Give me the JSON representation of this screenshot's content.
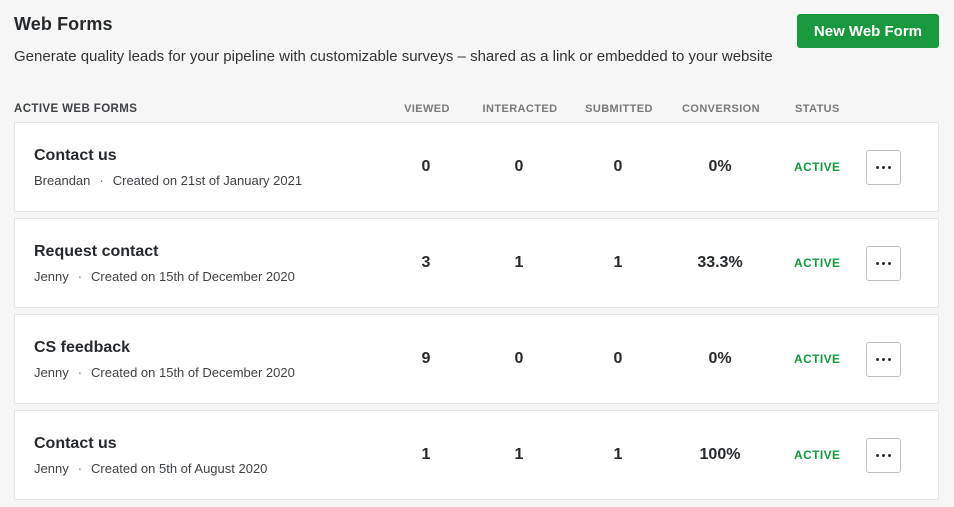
{
  "page": {
    "title": "Web Forms",
    "subtitle": "Generate quality leads for your pipeline with customizable surveys – shared as a link or embedded to your website",
    "new_button_label": "New Web Form"
  },
  "colors": {
    "button_green": "#18993d",
    "status_active_green": "#129c3e"
  },
  "table": {
    "meta_separator": "·",
    "headers": {
      "name": "ACTIVE WEB FORMS",
      "viewed": "VIEWED",
      "interacted": "INTERACTED",
      "submitted": "SUBMITTED",
      "conversion": "CONVERSION",
      "status": "STATUS"
    },
    "rows": [
      {
        "name": "Contact us",
        "owner": "Breandan",
        "created": "Created on 21st of January 2021",
        "viewed": "0",
        "interacted": "0",
        "submitted": "0",
        "conversion": "0%",
        "status": "ACTIVE"
      },
      {
        "name": "Request contact",
        "owner": "Jenny",
        "created": "Created on 15th of December 2020",
        "viewed": "3",
        "interacted": "1",
        "submitted": "1",
        "conversion": "33.3%",
        "status": "ACTIVE"
      },
      {
        "name": "CS feedback",
        "owner": "Jenny",
        "created": "Created on 15th of December 2020",
        "viewed": "9",
        "interacted": "0",
        "submitted": "0",
        "conversion": "0%",
        "status": "ACTIVE"
      },
      {
        "name": "Contact us",
        "owner": "Jenny",
        "created": "Created on 5th of August 2020",
        "viewed": "1",
        "interacted": "1",
        "submitted": "1",
        "conversion": "100%",
        "status": "ACTIVE"
      }
    ]
  }
}
